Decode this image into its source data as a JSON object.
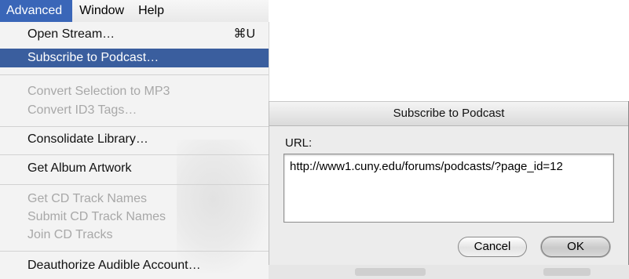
{
  "menubar": {
    "items": [
      "Advanced",
      "Window",
      "Help"
    ]
  },
  "menu": {
    "items": [
      {
        "label": "Open Stream…",
        "shortcut": "⌘U",
        "state": "enabled"
      },
      {
        "label": "Subscribe to Podcast…",
        "state": "highlighted"
      },
      {
        "label": "Convert Selection to MP3",
        "state": "disabled"
      },
      {
        "label": "Convert ID3 Tags…",
        "state": "disabled"
      },
      {
        "label": "Consolidate Library…",
        "state": "enabled"
      },
      {
        "label": "Get Album Artwork",
        "state": "enabled"
      },
      {
        "label": "Get CD Track Names",
        "state": "disabled"
      },
      {
        "label": "Submit CD Track Names",
        "state": "disabled"
      },
      {
        "label": "Join CD Tracks",
        "state": "disabled"
      },
      {
        "label": "Deauthorize Audible Account…",
        "state": "enabled"
      }
    ]
  },
  "dialog": {
    "title": "Subscribe to Podcast",
    "url_label": "URL:",
    "url_value": "http://www1.cuny.edu/forums/podcasts/?page_id=12",
    "cancel_label": "Cancel",
    "ok_label": "OK"
  },
  "colors": {
    "menu_highlight": "#3a5e9e",
    "menubar_active": "#3a66b8",
    "disabled_text": "#a8a8a8"
  }
}
